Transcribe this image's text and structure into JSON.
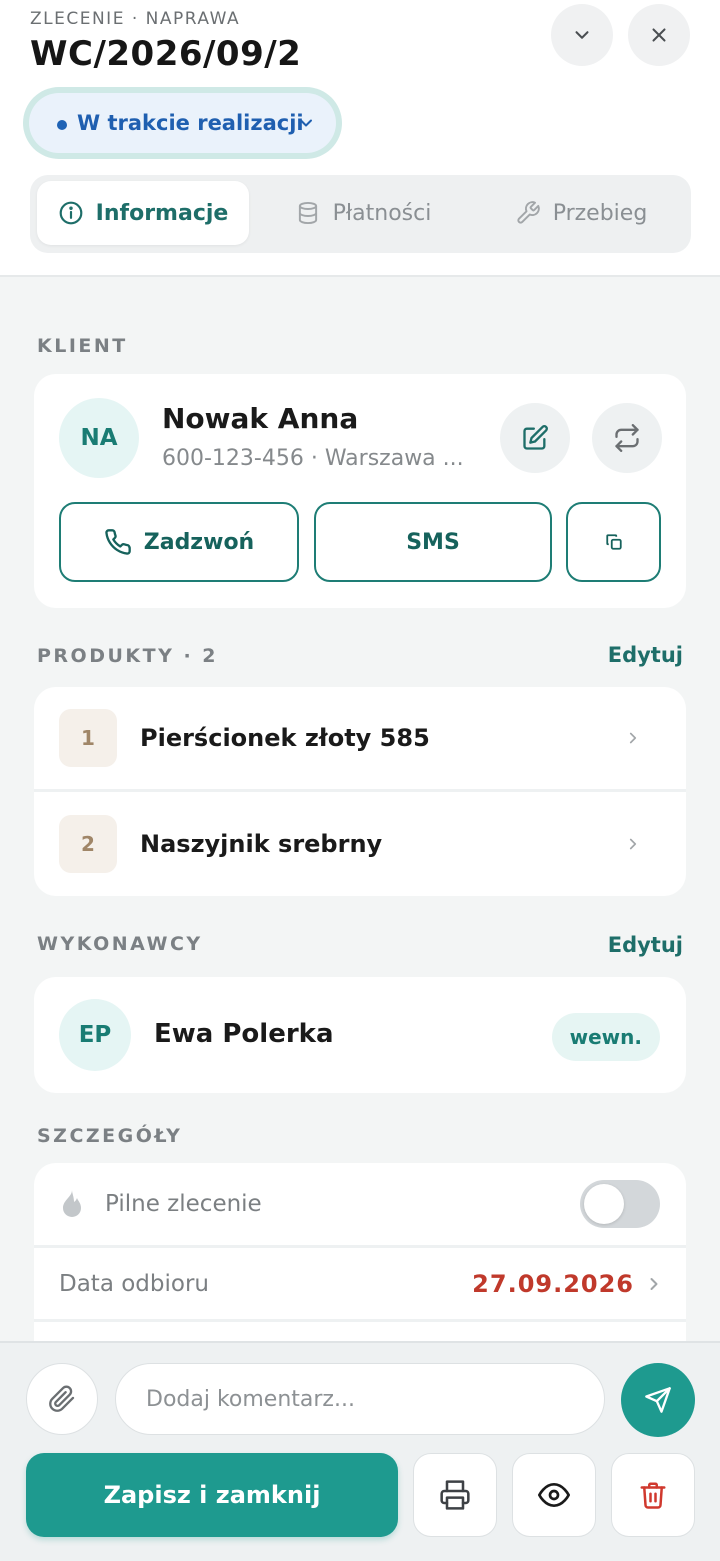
{
  "header": {
    "eyebrow": "ZLECENIE · NAPRAWA",
    "order_number": "WC/2026/09/2",
    "status": "W trakcie realizacji",
    "tabs": [
      {
        "label": "Informacje",
        "icon": "info-icon",
        "active": true
      },
      {
        "label": "Płatności",
        "icon": "database-icon",
        "active": false
      },
      {
        "label": "Przebieg",
        "icon": "wrench-icon",
        "active": false
      }
    ]
  },
  "client": {
    "section_label": "KLIENT",
    "initials": "NA",
    "name": "Nowak Anna",
    "meta": "600-123-456 · Warszawa ...",
    "call_label": "Zadzwoń",
    "sms_label": "SMS"
  },
  "products": {
    "section_label": "PRODUKTY · 2",
    "edit_label": "Edytuj",
    "items": [
      {
        "num": "1",
        "name": "Pierścionek złoty 585"
      },
      {
        "num": "2",
        "name": "Naszyjnik srebrny"
      }
    ]
  },
  "workers": {
    "section_label": "WYKONAWCY",
    "edit_label": "Edytuj",
    "items": [
      {
        "initials": "EP",
        "name": "Ewa Polerka",
        "badge": "wewn."
      }
    ]
  },
  "details": {
    "section_label": "SZCZEGÓŁY",
    "urgent_label": "Pilne zlecenie",
    "urgent_on": false,
    "pickup_label": "Data odbioru",
    "pickup_date": "27.09.2026"
  },
  "footer": {
    "comment_placeholder": "Dodaj komentarz...",
    "save_label": "Zapisz i zamknij"
  },
  "colors": {
    "accent": "#1e9a8f",
    "status_blue": "#1f5fb0",
    "date_red": "#c0392b"
  }
}
